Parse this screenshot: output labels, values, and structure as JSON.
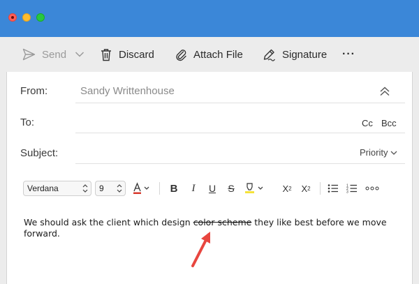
{
  "window": {
    "accent": "#3b87d8"
  },
  "toolbar": {
    "send_label": "Send",
    "discard_label": "Discard",
    "attach_label": "Attach File",
    "signature_label": "Signature",
    "more_label": "···"
  },
  "header": {
    "from_label": "From:",
    "from_value": "Sandy Writtenhouse",
    "to_label": "To:",
    "cc_label": "Cc",
    "bcc_label": "Bcc",
    "subject_label": "Subject:",
    "priority_label": "Priority"
  },
  "format": {
    "font_family": "Verdana",
    "font_size": "9",
    "text_color": "#d83a2e",
    "highlight_color": "#f5e23a"
  },
  "message": {
    "text_before": "We should ask the client which design ",
    "struck_text": "color scheme",
    "text_after": " they like best before we move forward."
  },
  "annotation": {
    "arrow_color": "#e8463f"
  }
}
